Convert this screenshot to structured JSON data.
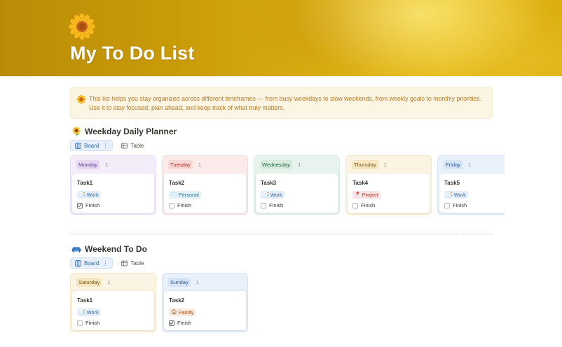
{
  "page": {
    "title": "My To Do List",
    "icon": "sunflower-icon",
    "callout": {
      "icon": "sunflower-icon",
      "line1": "This list helps you stay organized across different timeframes — from busy weekdays to slow weekends, from weekly goals to monthly priorities.",
      "line2": "Use it to stay focused, plan ahead, and keep track of what truly matters."
    }
  },
  "weekday": {
    "title": "Weekday Daily Planner",
    "icon": "sunflower-icon",
    "views": [
      {
        "label": "Board",
        "icon": "board-icon",
        "active": true,
        "more": "⋮"
      },
      {
        "label": "Table",
        "icon": "table-icon",
        "active": false
      }
    ],
    "columns": [
      {
        "name": "Monday",
        "count": "1",
        "theme": "purple",
        "card": {
          "title": "Task1",
          "tag": "Work",
          "tag_emoji": "📑",
          "tag_theme": "work",
          "check_label": "Finish",
          "checked": true
        }
      },
      {
        "name": "Tuesday",
        "count": "1",
        "theme": "red",
        "card": {
          "title": "Task2",
          "tag": "Personal",
          "tag_emoji": "📨",
          "tag_theme": "personal",
          "check_label": "Finish",
          "checked": false
        }
      },
      {
        "name": "Wednesday",
        "count": "1",
        "theme": "green",
        "card": {
          "title": "Task3",
          "tag": "Work",
          "tag_emoji": "📑",
          "tag_theme": "work",
          "check_label": "Finish",
          "checked": false
        }
      },
      {
        "name": "Thursday",
        "count": "1",
        "theme": "yellow",
        "card": {
          "title": "Task4",
          "tag": "Project",
          "tag_emoji": "📍",
          "tag_theme": "project",
          "check_label": "Finish",
          "checked": false
        }
      },
      {
        "name": "Friday",
        "count": "1",
        "theme": "blue",
        "card": {
          "title": "Task5",
          "tag": "Work",
          "tag_emoji": "📑",
          "tag_theme": "work",
          "check_label": "Finish",
          "checked": false
        }
      }
    ]
  },
  "weekend": {
    "title": "Weekend To Do",
    "icon": "couch-icon",
    "views": [
      {
        "label": "Board",
        "icon": "board-icon",
        "active": true,
        "more": "⋮"
      },
      {
        "label": "Table",
        "icon": "table-icon",
        "active": false
      }
    ],
    "columns": [
      {
        "name": "Saturday",
        "count": "1",
        "theme": "yellow",
        "card": {
          "title": "Task1",
          "tag": "Work",
          "tag_emoji": "📑",
          "tag_theme": "work",
          "check_label": "Finish",
          "checked": false
        }
      },
      {
        "name": "Sunday",
        "count": "1",
        "theme": "blue",
        "card": {
          "title": "Task2",
          "tag": "Family",
          "tag_emoji": "🏠",
          "tag_theme": "family",
          "check_label": "Finish",
          "checked": true
        }
      }
    ]
  }
}
